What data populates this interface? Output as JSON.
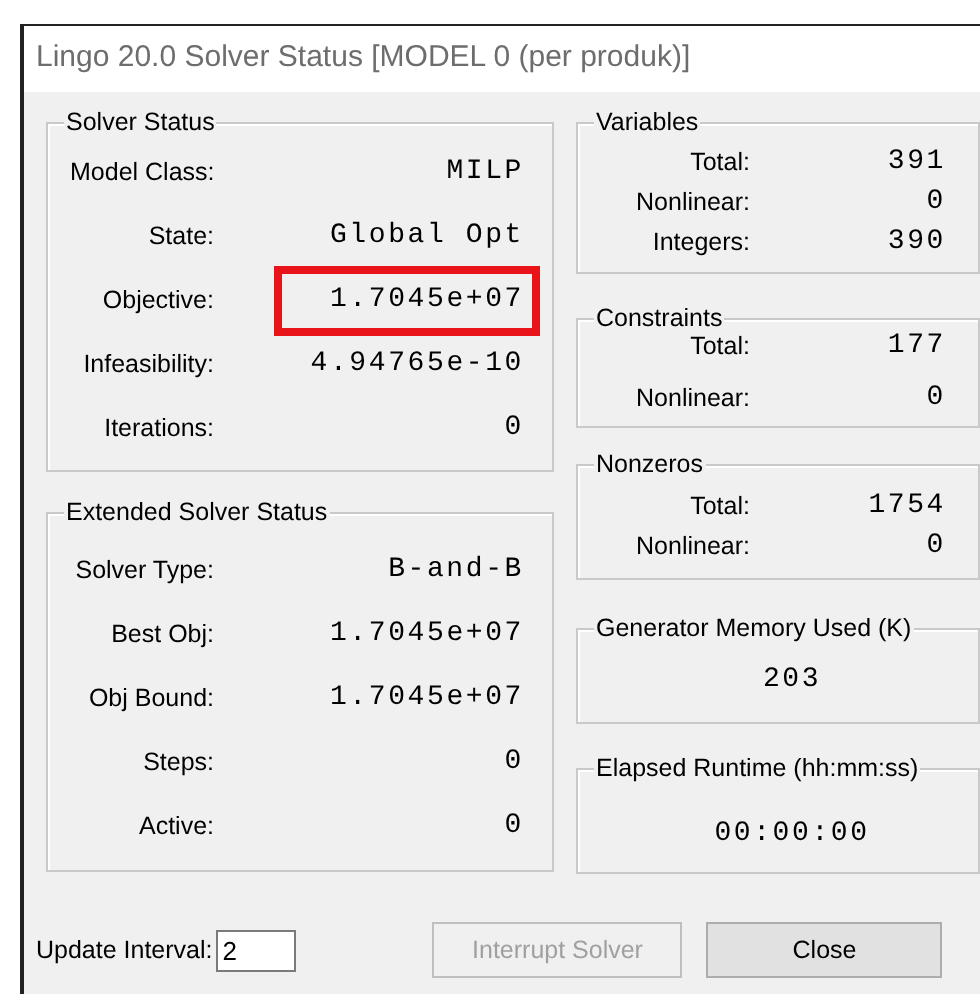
{
  "window": {
    "title": "Lingo 20.0 Solver Status [MODEL 0 (per produk)]"
  },
  "solver_status": {
    "title": "Solver Status",
    "rows": [
      {
        "label": "Model Class:",
        "value": "MILP",
        "highlighted": false
      },
      {
        "label": "State:",
        "value": "Global Opt",
        "highlighted": false
      },
      {
        "label": "Objective:",
        "value": "1.7045e+07",
        "highlighted": true
      },
      {
        "label": "Infeasibility:",
        "value": "4.94765e-10",
        "highlighted": false
      },
      {
        "label": "Iterations:",
        "value": "0",
        "highlighted": false
      }
    ]
  },
  "extended_solver_status": {
    "title": "Extended Solver Status",
    "rows": [
      {
        "label": "Solver Type:",
        "value": "B-and-B"
      },
      {
        "label": "Best Obj:",
        "value": "1.7045e+07"
      },
      {
        "label": "Obj Bound:",
        "value": "1.7045e+07"
      },
      {
        "label": "Steps:",
        "value": "0"
      },
      {
        "label": "Active:",
        "value": "0"
      }
    ]
  },
  "variables": {
    "title": "Variables",
    "rows": [
      {
        "label": "Total:",
        "value": "391"
      },
      {
        "label": "Nonlinear:",
        "value": "0"
      },
      {
        "label": "Integers:",
        "value": "390"
      }
    ]
  },
  "constraints": {
    "title": "Constraints",
    "rows": [
      {
        "label": "Total:",
        "value": "177"
      },
      {
        "label": "Nonlinear:",
        "value": "0"
      }
    ]
  },
  "nonzeros": {
    "title": "Nonzeros",
    "rows": [
      {
        "label": "Total:",
        "value": "1754"
      },
      {
        "label": "Nonlinear:",
        "value": "0"
      }
    ]
  },
  "generator_memory": {
    "title": "Generator Memory Used (K)",
    "value": "203"
  },
  "elapsed_runtime": {
    "title": "Elapsed Runtime (hh:mm:ss)",
    "value": "00:00:00"
  },
  "update_interval": {
    "label": "Update Interval:",
    "value": "2"
  },
  "buttons": [
    {
      "label": "Interrupt Solver",
      "disabled": true
    },
    {
      "label": "Close",
      "disabled": false
    }
  ]
}
